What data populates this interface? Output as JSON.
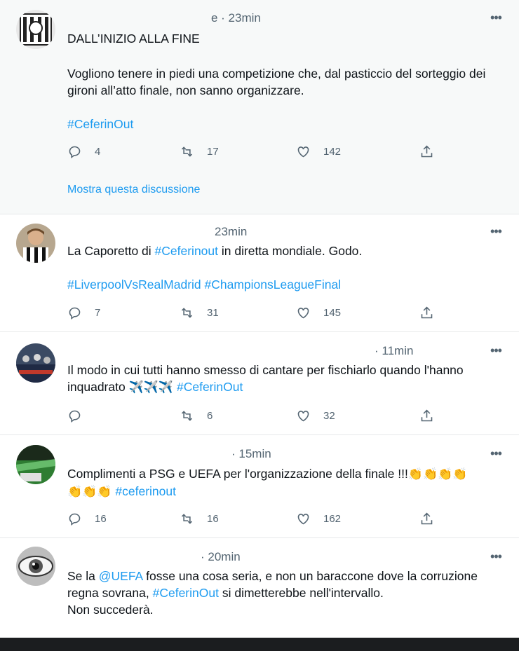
{
  "tweets": [
    {
      "time": "e · 23min",
      "text_lines": [
        "DALL’INIZIO ALLA FINE"
      ],
      "body": "Vogliono tenere in piedi una competizione che, dal pasticcio del sorteggio dei gironi all’atto finale, non sanno organizzare.",
      "hashtag": "#CeferinOut",
      "replies": "4",
      "retweets": "17",
      "likes": "142",
      "show_thread": "Mostra questa discussione"
    },
    {
      "time": "23min",
      "text_before": "La Caporetto di ",
      "tag1": "#Ceferinout",
      "text_after": " in diretta mondiale. Godo.",
      "tags_line": "#LiverpoolVsRealMadrid #ChampionsLeagueFinal",
      "replies": "7",
      "retweets": "31",
      "likes": "145"
    },
    {
      "time": "· 11min",
      "text": "Il modo in cui tutti hanno smesso di cantare per fischiarlo quando l'hanno inquadrato",
      "emoji": "✈️✈️✈️",
      "hashtag": "#CeferinOut",
      "replies": "",
      "retweets": "6",
      "likes": "32"
    },
    {
      "time": "· 15min",
      "text": "Complimenti a PSG e UEFA per l'organizzazione della finale !!!",
      "emoji_a": "👏👏👏👏",
      "emoji_b": "👏👏👏",
      "hashtag": "#ceferinout",
      "replies": "16",
      "retweets": "16",
      "likes": "162"
    },
    {
      "time": "· 20min",
      "text_1": "Se la ",
      "mention": "@UEFA",
      "text_2": " fosse una cosa seria, e non un baraccone dove la corruzione regna sovrana, ",
      "hashtag": "#CeferinOut",
      "text_3": " si dimetterebbe nell'intervallo.",
      "text_4": "Non succederà."
    }
  ],
  "more_icon": "more-horizontal-icon",
  "colors": {
    "link": "#1d9bf0",
    "muted": "#536471",
    "text": "#0f1419",
    "divider": "#e7e9ea"
  }
}
